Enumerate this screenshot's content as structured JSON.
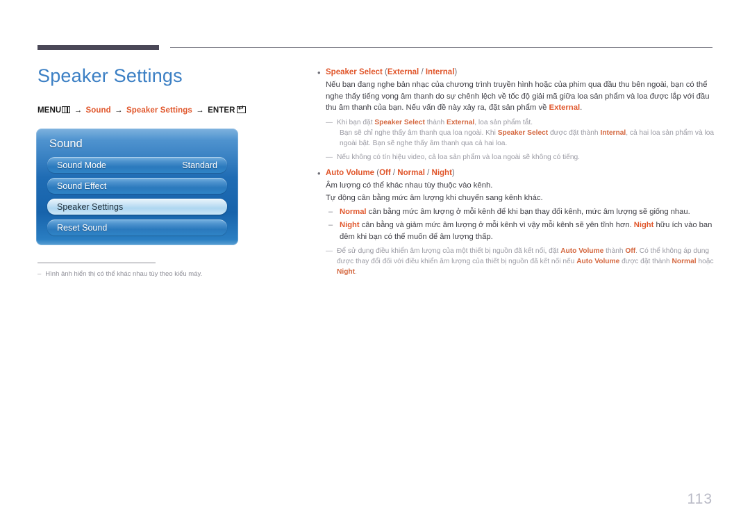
{
  "page": {
    "title": "Speaker Settings",
    "number": "113"
  },
  "menu_path": {
    "menu_label": "MENU",
    "menu_icon": "menu-grid-icon",
    "arrow": "→",
    "step1": "Sound",
    "step2": "Speaker Settings",
    "enter_label": "ENTER",
    "enter_icon": "enter-return-icon"
  },
  "osd": {
    "title": "Sound",
    "rows": [
      {
        "label": "Sound Mode",
        "value": "Standard",
        "selected": false
      },
      {
        "label": "Sound Effect",
        "value": "",
        "selected": false
      },
      {
        "label": "Speaker Settings",
        "value": "",
        "selected": true
      },
      {
        "label": "Reset Sound",
        "value": "",
        "selected": false
      }
    ]
  },
  "left_note": {
    "dash": "–",
    "text": "Hình ảnh hiển thị có thể khác nhau tùy theo kiểu máy."
  },
  "content": {
    "bullet_glyph": "•",
    "note_dash": "—",
    "sub_dash": "–",
    "speaker_select": {
      "heading_name": "Speaker Select",
      "heading_open": " (",
      "opt1": "External",
      "opt_sep": " / ",
      "opt2": "Internal",
      "heading_close": ")",
      "para_a": "Nếu bạn đang nghe bản nhạc của chương trình truyền hình hoặc của phim qua đầu thu bên ngoài, bạn có thể nghe thấy tiếng vọng âm thanh do sự chênh lệch về tốc độ giải mã giữa loa sản phẩm và loa được lắp với đầu thu âm thanh của bạn. Nếu vấn đề này xảy ra, đặt sản phẩm về ",
      "para_a_end_bold": "External",
      "para_a_period": ".",
      "note1_part1": "Khi bạn đặt ",
      "note1_b1": "Speaker Select",
      "note1_part2": " thành ",
      "note1_b2": "External",
      "note1_part3": ", loa sản phẩm tắt.",
      "note1_cont1": "Bạn sẽ chỉ nghe thấy âm thanh qua loa ngoài. Khi ",
      "note1_cont_b1": "Speaker Select",
      "note1_cont2": " được đặt thành ",
      "note1_cont_b2": "Internal",
      "note1_cont3": ", cả hai loa sản phẩm và loa ngoài bật. Bạn sẽ nghe thấy âm thanh qua cả hai loa.",
      "note2": "Nếu không có tín hiệu video, cả loa sản phẩm và loa ngoài sẽ không có tiếng."
    },
    "auto_volume": {
      "heading_name": "Auto Volume",
      "heading_open": " (",
      "opt1": "Off",
      "opt_sep1": " / ",
      "opt2": "Normal",
      "opt_sep2": " / ",
      "opt3": "Night",
      "heading_close": ")",
      "para_a": "Âm lượng có thể khác nhau tùy thuộc vào kênh.",
      "para_b": "Tự động cân bằng mức âm lượng khi chuyển sang kênh khác.",
      "sub1_b": "Normal",
      "sub1_text": " cân bằng mức âm lượng ở mỗi kênh để khi bạn thay đổi kênh, mức âm lượng sẽ giống nhau.",
      "sub2_b1": "Night",
      "sub2_text1": " cân bằng và giảm mức âm lượng ở mỗi kênh vì vậy mỗi kênh sẽ yên tĩnh hơn. ",
      "sub2_b2": "Night",
      "sub2_text2": " hữu ích vào ban đêm khi bạn có thể muốn để âm lượng thấp.",
      "note1_part1": "Để sử dụng điều khiển âm lượng của một thiết bị nguồn đã kết nối, đặt ",
      "note1_b1": "Auto Volume",
      "note1_part2": " thành ",
      "note1_b2": "Off",
      "note1_part3": ". Có thể không áp dụng được thay đổi đối với điều khiển âm lượng của thiết bị nguồn đã kết nối nếu ",
      "note1_b3": "Auto Volume",
      "note1_part4": " được đặt thành ",
      "note1_b4": "Normal",
      "note1_part5": " hoặc ",
      "note1_b5": "Night",
      "note1_part6": "."
    }
  },
  "colors": {
    "accent_orange": "#e0562b",
    "title_blue": "#3b7fc4",
    "rule_dark": "#4a4857",
    "note_gray": "#9a9aa3",
    "page_num": "#b9bac6"
  }
}
